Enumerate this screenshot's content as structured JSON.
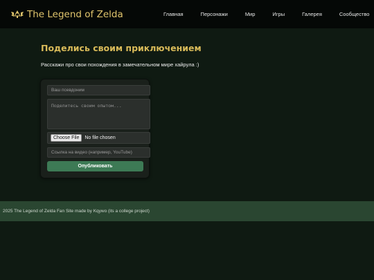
{
  "header": {
    "site_title": "The Legend of Zelda",
    "logo_icon": "triforce-wings-icon",
    "accent_color": "#e0c46c",
    "nav": [
      {
        "label": "Главная"
      },
      {
        "label": "Персонажи"
      },
      {
        "label": "Мир"
      },
      {
        "label": "Игры"
      },
      {
        "label": "Галерея"
      },
      {
        "label": "Сообщество"
      }
    ]
  },
  "main": {
    "title": "Поделись своим приключением",
    "subtitle": "Расскажи про свои похождения в замечательном мире хайрула :)"
  },
  "form": {
    "name_placeholder": "Ваш псевдоним",
    "story_placeholder": "Поделитесь своим опытом...",
    "file_button": "Choose File",
    "file_status": "No file chosen",
    "video_placeholder": "Ссылка на видео (например, YouTube)",
    "submit_label": "Опубликовать",
    "submit_color": "#3d7a55"
  },
  "footer": {
    "text": "2025 The Legend of Zelda Fan Site made by Kqywo (its a college project)"
  }
}
